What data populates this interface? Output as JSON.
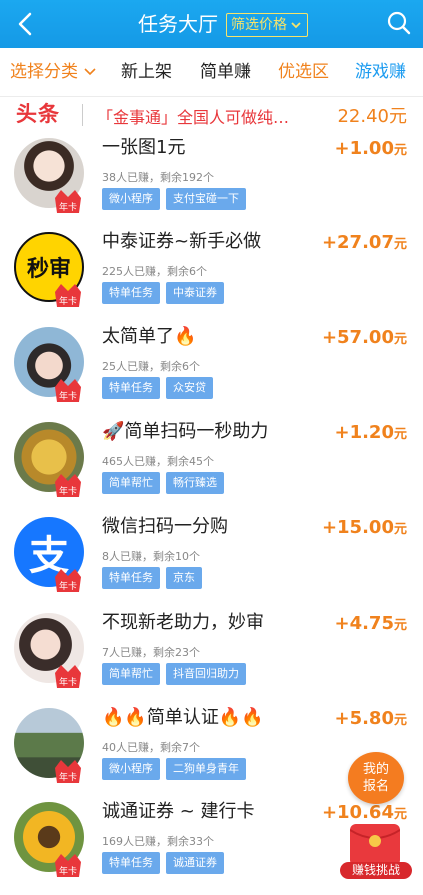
{
  "header": {
    "title": "任务大厅",
    "filter_label": "筛选价格"
  },
  "tabs": [
    {
      "label": "选择分类"
    },
    {
      "label": "新上架"
    },
    {
      "label": "简单赚"
    },
    {
      "label": "优选区"
    },
    {
      "label": "游戏赚"
    }
  ],
  "news": {
    "tag": "头条",
    "text": "「金事通」全国人可做纯…",
    "amount": "22.40元"
  },
  "tasks": [
    {
      "name": "一张图1元",
      "stats": "38人已赚，剩余192个",
      "tags": [
        "微小程序",
        "支付宝碰一下"
      ],
      "price": "+1.00",
      "unit": "元",
      "avatar": "girl-avatar",
      "badge": "年卡"
    },
    {
      "name": "中泰证券~新手必做",
      "stats": "225人已赚，剩余6个",
      "tags": [
        "特单任务",
        "中泰证券"
      ],
      "price": "+27.07",
      "unit": "元",
      "avatar_text": "秒审",
      "badge": "年卡"
    },
    {
      "name": "太简单了🔥",
      "stats": "25人已赚，剩余6个",
      "tags": [
        "特单任务",
        "众安贷"
      ],
      "price": "+57.00",
      "unit": "元",
      "avatar": "girl-avatar",
      "badge": "年卡"
    },
    {
      "name": "🚀简单扫码一秒助力",
      "stats": "465人已赚，剩余45个",
      "tags": [
        "简单帮忙",
        "畅行臻选"
      ],
      "price": "+1.20",
      "unit": "元",
      "avatar": "lion-avatar",
      "badge": "年卡"
    },
    {
      "name": "微信扫码一分购",
      "stats": "8人已赚，剩余10个",
      "tags": [
        "特单任务",
        "京东"
      ],
      "price": "+15.00",
      "unit": "元",
      "avatar_text": "支",
      "badge": "年卡"
    },
    {
      "name": "不现新老助力，妙审",
      "stats": "7人已赚，剩余23个",
      "tags": [
        "简单帮忙",
        "抖音回归助力"
      ],
      "price": "+4.75",
      "unit": "元",
      "avatar": "girl-avatar",
      "badge": "年卡"
    },
    {
      "name": "🔥🔥简单认证🔥🔥",
      "stats": "40人已赚，剩余7个",
      "tags": [
        "微小程序",
        "二狗单身青年"
      ],
      "price": "+5.80",
      "unit": "元",
      "avatar": "landscape-avatar",
      "badge": "年卡"
    },
    {
      "name": "诚通证券 ~ 建行卡",
      "stats": "169人已赚，剩余33个",
      "tags": [
        "特单任务",
        "诚通证券"
      ],
      "price": "+10.64",
      "unit": "元",
      "avatar": "sunflower-avatar",
      "badge": "年卡"
    }
  ],
  "floating": {
    "report_line1": "我的",
    "report_line2": "报名",
    "challenge_label": "赚钱挑战"
  },
  "colors": {
    "header": "#1ba8f0",
    "accent": "#f0821d",
    "chip": "#6aa9ec",
    "headline": "#e8373b"
  }
}
